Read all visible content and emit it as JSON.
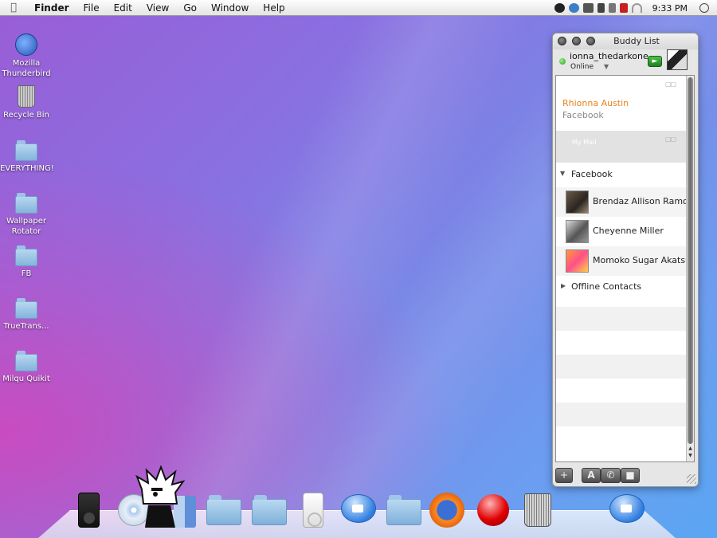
{
  "menubar": {
    "apple_icon": "apple-logo-icon",
    "items": [
      "Finder",
      "File",
      "Edit",
      "View",
      "Go",
      "Window",
      "Help"
    ],
    "clock": "9:33 PM"
  },
  "desktop": {
    "icons": [
      {
        "label": "Mozilla Thunderbird",
        "icon": "thunderbird-icon"
      },
      {
        "label": "Recycle Bin",
        "icon": "trash-icon"
      },
      {
        "label": "EVERYTHING!",
        "icon": "folder-icon"
      },
      {
        "label": "Wallpaper Rotator",
        "icon": "folder-icon"
      },
      {
        "label": "FB",
        "icon": "folder-icon"
      },
      {
        "label": "TrueTrans...",
        "icon": "folder-icon"
      },
      {
        "label": "Milqu Quikit",
        "icon": "folder-icon"
      }
    ]
  },
  "buddy_list": {
    "title": "Buddy List",
    "account_name": "ionna_thedarkone",
    "status": "Online",
    "recent": {
      "name": "Rhionna Austin",
      "service": "Facebook"
    },
    "my_mail_label": "My Mail",
    "group_label": "Facebook",
    "contacts": [
      {
        "name": "Brendaz Allison Ramos"
      },
      {
        "name": "Cheyenne Miller"
      },
      {
        "name": "Momoko Sugar Akatsuki"
      }
    ],
    "offline_label": "Offline Contacts",
    "add_button": "+",
    "font_button": "A"
  },
  "colors": {
    "accent_orange": "#e8831e",
    "online_green": "#2c9a1d"
  },
  "dock": {
    "items": [
      "ipod-dark-icon",
      "itunes-icon",
      "character-icon",
      "finder-icon",
      "folder-icon",
      "folder-icon",
      "ipod-white-icon",
      "video-chat-icon",
      "folder-icon",
      "firefox-icon",
      "record-icon",
      "trash-icon",
      "video-chat-icon"
    ]
  }
}
